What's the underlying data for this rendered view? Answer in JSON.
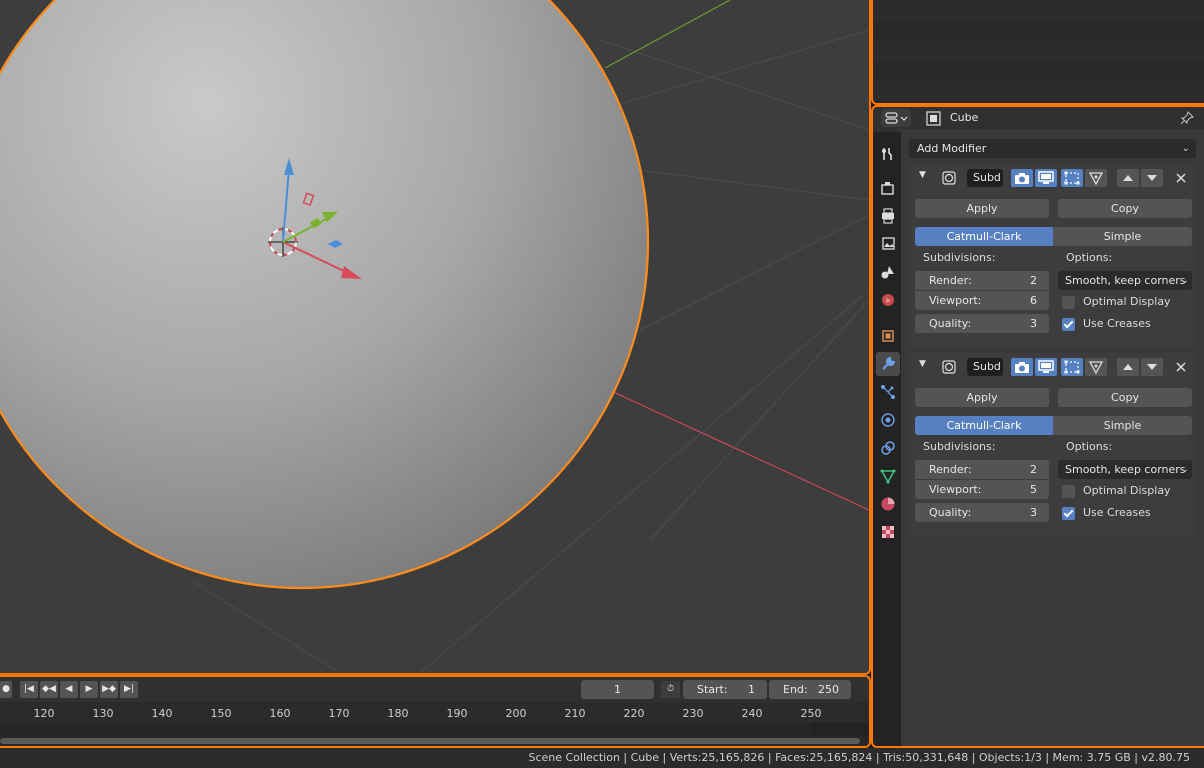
{
  "viewport": {
    "name": "3D Viewport"
  },
  "timeline": {
    "current_frame": "1",
    "start_label": "Start:",
    "start_value": "1",
    "end_label": "End:",
    "end_value": "250",
    "ticks": [
      "120",
      "130",
      "140",
      "150",
      "160",
      "170",
      "180",
      "190",
      "200",
      "210",
      "220",
      "230",
      "240",
      "250"
    ]
  },
  "properties": {
    "object_name": "Cube",
    "add_modifier": "Add Modifier",
    "modifiers": [
      {
        "name": "Subd",
        "apply": "Apply",
        "copy": "Copy",
        "mode_catmull": "Catmull-Clark",
        "mode_simple": "Simple",
        "subdivisions_label": "Subdivisions:",
        "options_label": "Options:",
        "render_label": "Render:",
        "render_value": "2",
        "viewport_label": "Viewport:",
        "viewport_value": "6",
        "quality_label": "Quality:",
        "quality_value": "3",
        "uv_smooth": "Smooth, keep corners",
        "optimal_display": "Optimal Display",
        "optimal_display_checked": false,
        "use_creases": "Use Creases",
        "use_creases_checked": true
      },
      {
        "name": "Subd",
        "apply": "Apply",
        "copy": "Copy",
        "mode_catmull": "Catmull-Clark",
        "mode_simple": "Simple",
        "subdivisions_label": "Subdivisions:",
        "options_label": "Options:",
        "render_label": "Render:",
        "render_value": "2",
        "viewport_label": "Viewport:",
        "viewport_value": "5",
        "quality_label": "Quality:",
        "quality_value": "3",
        "uv_smooth": "Smooth, keep corners",
        "optimal_display": "Optimal Display",
        "optimal_display_checked": false,
        "use_creases": "Use Creases",
        "use_creases_checked": true
      }
    ],
    "tabs": [
      "tool",
      "render",
      "output",
      "view-layer",
      "scene",
      "world",
      "object",
      "modifiers",
      "particles",
      "physics",
      "constraints",
      "data",
      "material",
      "texture"
    ]
  },
  "status_bar": {
    "text": "Scene Collection | Cube | Verts:25,165,826 | Faces:25,165,824 | Tris:50,331,648 | Objects:1/3 | Mem: 3.75 GB | v2.80.75"
  },
  "colors": {
    "accent": "#ff7700",
    "selected_blue": "#5680c2",
    "x_axis": "#d64a5a",
    "y_axis": "#7ab32e",
    "z_axis": "#4a8fd8"
  }
}
